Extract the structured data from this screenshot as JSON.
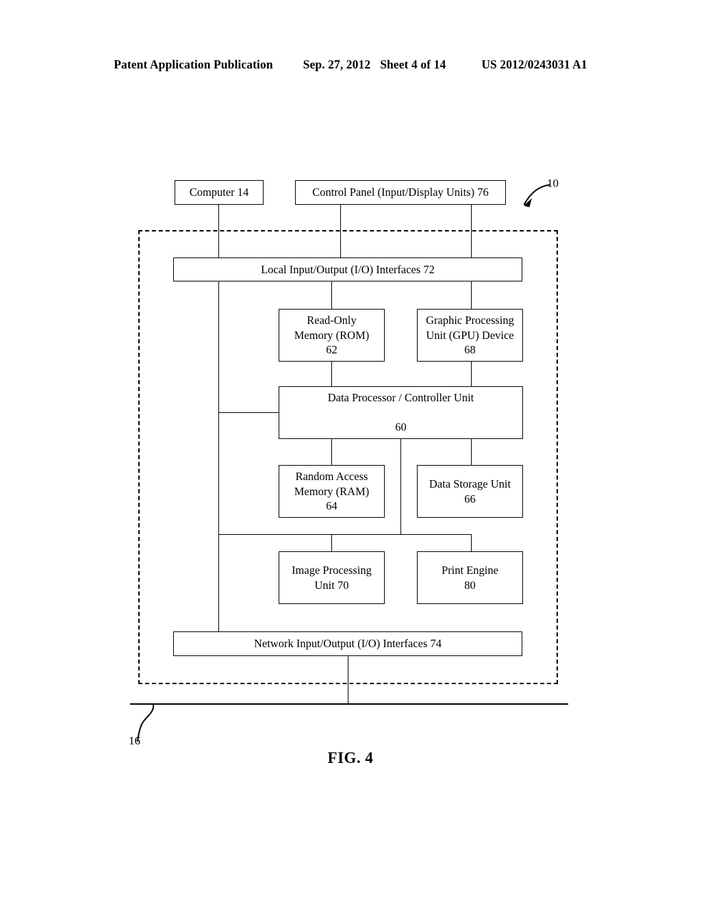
{
  "header": {
    "publication": "Patent Application Publication",
    "date": "Sep. 27, 2012",
    "sheet": "Sheet 4 of 14",
    "patent_number": "US 2012/0243031 A1"
  },
  "figure": {
    "caption": "FIG. 4",
    "device_reference": "10",
    "network_reference": "16",
    "nodes": {
      "computer": "Computer 14",
      "control_panel": "Control Panel (Input/Display Units) 76",
      "local_io": "Local Input/Output (I/O) Interfaces 72",
      "rom": "Read-Only\nMemory (ROM)\n62",
      "gpu": "Graphic Processing\nUnit (GPU) Device\n68",
      "data_processor": "Data Processor / Controller Unit\n\n60",
      "ram": "Random Access\nMemory (RAM)\n64",
      "data_storage": "Data Storage Unit\n66",
      "image_processing": "Image Processing\nUnit 70",
      "print_engine": "Print Engine\n80",
      "network_io": "Network Input/Output (I/O) Interfaces 74"
    }
  }
}
